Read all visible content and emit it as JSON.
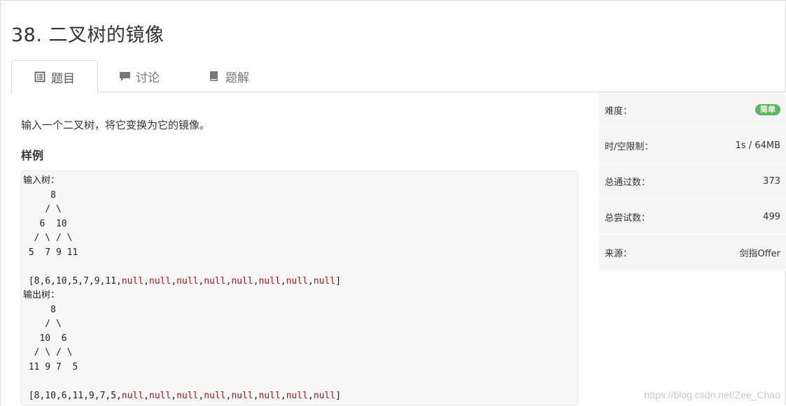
{
  "problem": {
    "title": "38. 二叉树的镜像"
  },
  "tabs": [
    {
      "label": "题目",
      "icon": "document-list-icon"
    },
    {
      "label": "讨论",
      "icon": "chat-bubble-icon"
    },
    {
      "label": "题解",
      "icon": "book-icon"
    }
  ],
  "content": {
    "description": "输入一个二叉树，将它变换为它的镜像。",
    "sample_heading": "样例",
    "code": {
      "input_label": "输入树：",
      "input_tree": [
        "     8",
        "    / \\",
        "   6  10",
        "  / \\ / \\",
        " 5  7 9 11"
      ],
      "input_array_prefix": "[8,6,10,5,7,9,11,",
      "input_nulls": [
        "null",
        "null",
        "null",
        "null",
        "null",
        "null",
        "null",
        "null"
      ],
      "output_label": "输出树：",
      "output_tree": [
        "     8",
        "    / \\",
        "   10  6",
        "  / \\ / \\",
        " 11 9 7  5"
      ],
      "output_array_prefix": "[8,10,6,11,9,7,5,",
      "output_nulls": [
        "null",
        "null",
        "null",
        "null",
        "null",
        "null",
        "null",
        "null"
      ],
      "array_suffix": "]"
    }
  },
  "sidebar": {
    "difficulty_label": "难度：",
    "difficulty_value": "简单",
    "limit_label": "时/空限制：",
    "limit_value": "1s / 64MB",
    "passed_label": "总通过数：",
    "passed_value": "373",
    "tried_label": "总尝试数：",
    "tried_value": "499",
    "source_label": "来源：",
    "source_value": "剑指Offer"
  },
  "watermark": "https://blog.csdn.net/Zee_Chao",
  "colors": {
    "badge": "#5cb85c",
    "null_keyword": "#aa1111"
  }
}
